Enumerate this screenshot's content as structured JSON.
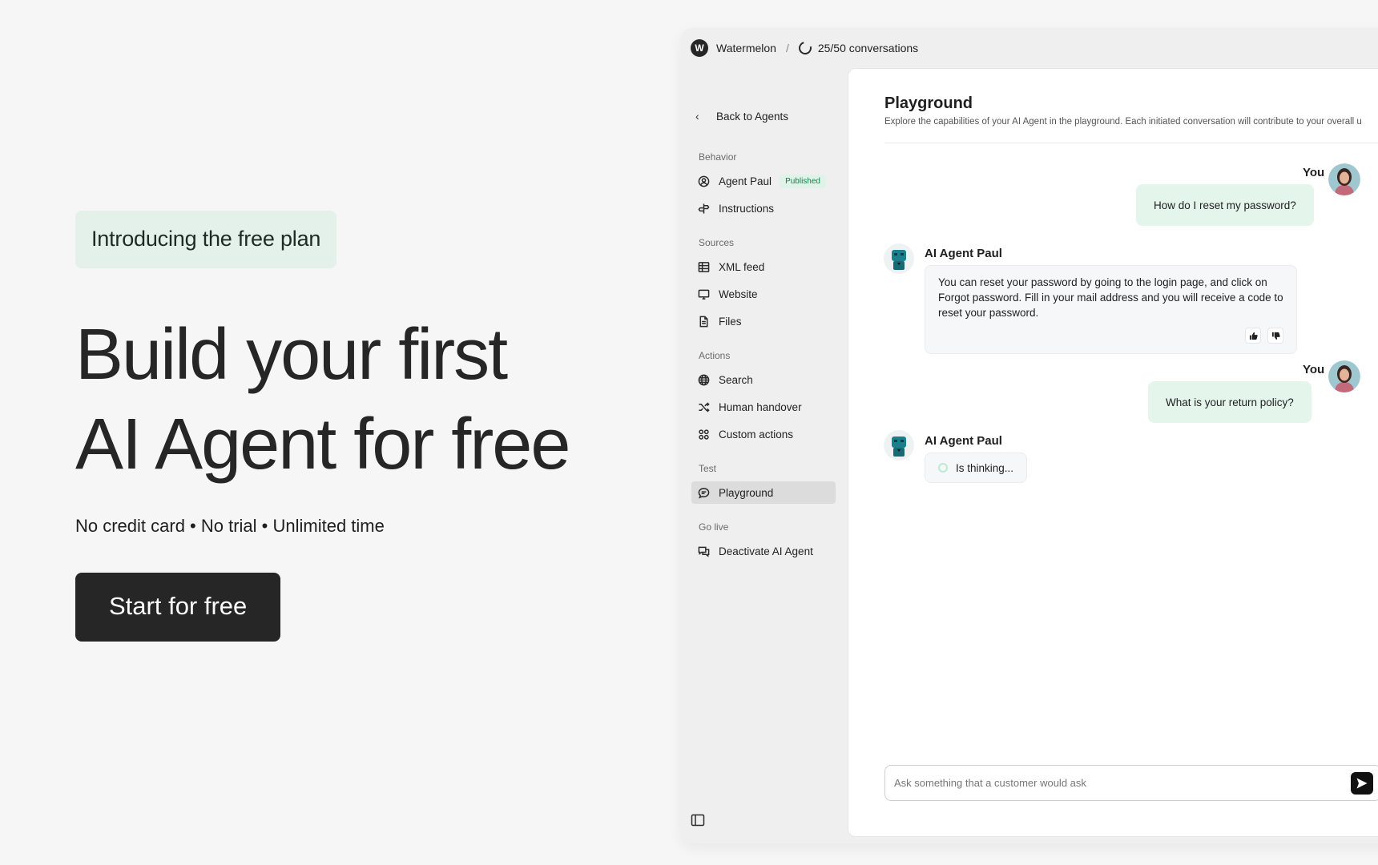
{
  "hero": {
    "pill": "Introducing the free plan",
    "headline_line1": "Build your first",
    "headline_line2": "AI Agent for free",
    "subline": "No credit card • No trial • Unlimited time",
    "cta": "Start for free"
  },
  "topbar": {
    "workspace_initial": "W",
    "workspace_name": "Watermelon",
    "separator": "/",
    "conversations": "25/50 conversations"
  },
  "sidebar": {
    "back": "Back to Agents",
    "sections": {
      "behavior": "Behavior",
      "sources": "Sources",
      "actions": "Actions",
      "test": "Test",
      "golive": "Go live"
    },
    "items": {
      "agent": "Agent Paul",
      "agent_badge": "Published",
      "instructions": "Instructions",
      "xml": "XML feed",
      "website": "Website",
      "files": "Files",
      "search": "Search",
      "handover": "Human handover",
      "custom": "Custom actions",
      "playground": "Playground",
      "deactivate": "Deactivate AI Agent"
    }
  },
  "main": {
    "title": "Playground",
    "description": "Explore the capabilities of your AI Agent in the playground. Each initiated conversation will contribute to your overall u",
    "messages": {
      "you_label": "You",
      "agent_label": "AI Agent Paul",
      "q1": "How do I reset my password?",
      "a1": "You can reset your password by going to the login page, and click on Forgot password. Fill in your mail address and you will receive a code to reset your password.",
      "q2": "What is your return policy?",
      "thinking": "Is thinking..."
    },
    "composer_placeholder": "Ask something that a customer would ask"
  },
  "colors": {
    "accent_green_bg": "#e4f5ec",
    "published_text": "#1f7a4b",
    "dark": "#262626"
  }
}
